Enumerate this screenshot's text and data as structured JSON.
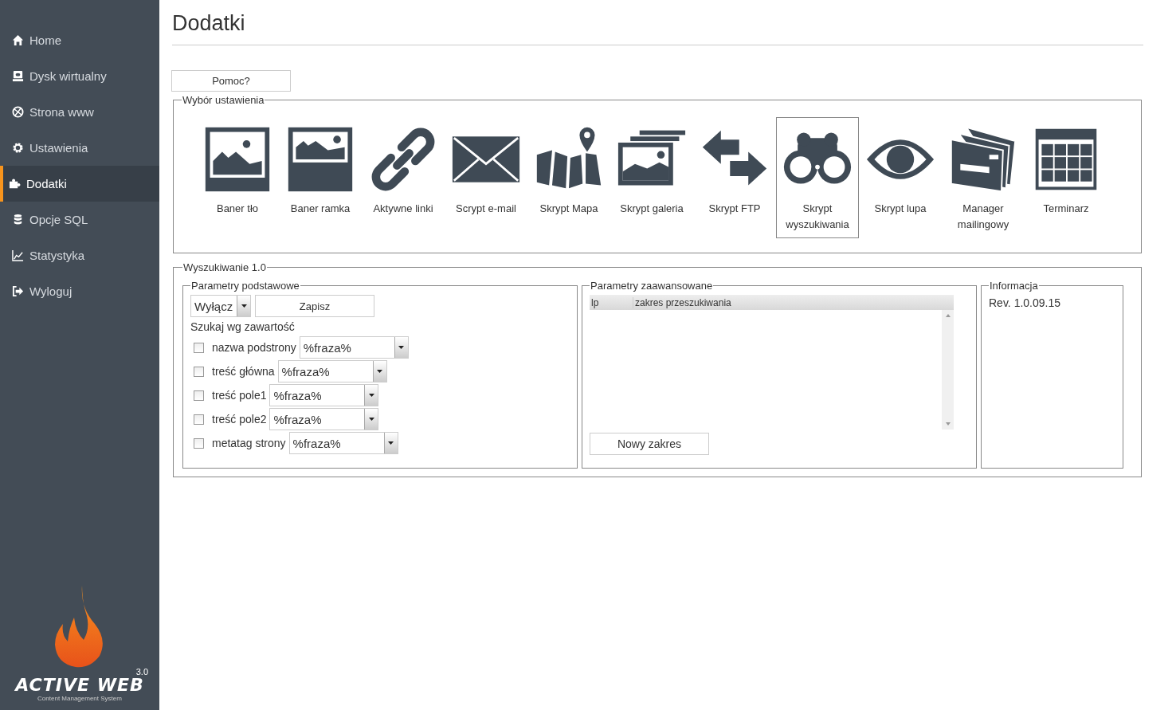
{
  "sidebar": {
    "items": [
      {
        "label": "Home",
        "selected": false
      },
      {
        "label": "Dysk wirtualny",
        "selected": false
      },
      {
        "label": "Strona www",
        "selected": false
      },
      {
        "label": "Ustawienia",
        "selected": false
      },
      {
        "label": "Dodatki",
        "selected": true
      },
      {
        "label": "Opcje SQL",
        "selected": false
      },
      {
        "label": "Statystyka",
        "selected": false
      },
      {
        "label": "Wyloguj",
        "selected": false
      }
    ],
    "logo": {
      "name": "ACTIVE WEB",
      "version": "3.0",
      "tagline": "Content Management System"
    }
  },
  "page_title": "Dodatki",
  "help_button": "Pomoc?",
  "plugins": {
    "legend": "Wybór ustawienia",
    "items": [
      {
        "label": "Baner tło",
        "selected": false
      },
      {
        "label": "Baner ramka",
        "selected": false
      },
      {
        "label": "Aktywne linki",
        "selected": false
      },
      {
        "label": "Scrypt e-mail",
        "selected": false
      },
      {
        "label": "Skrypt Mapa",
        "selected": false
      },
      {
        "label": "Skrypt galeria",
        "selected": false
      },
      {
        "label": "Skrypt FTP",
        "selected": false
      },
      {
        "label": "Skrypt wyszukiwania",
        "selected": true
      },
      {
        "label": "Skrypt lupa",
        "selected": false
      },
      {
        "label": "Manager mailingowy",
        "selected": false
      },
      {
        "label": "Terminarz",
        "selected": false
      }
    ]
  },
  "search": {
    "legend": "Wyszukiwanie 1.0",
    "basic": {
      "legend": "Parametry podstawowe",
      "mode": "Wyłącz",
      "save_button": "Zapisz",
      "section_label": "Szukaj wg zawartość",
      "fields": [
        {
          "label": "nazwa podstrony",
          "checked": false,
          "value": "%fraza%"
        },
        {
          "label": "treść główna",
          "checked": false,
          "value": "%fraza%"
        },
        {
          "label": "treść pole1",
          "checked": false,
          "value": "%fraza%"
        },
        {
          "label": "treść pole2",
          "checked": false,
          "value": "%fraza%"
        },
        {
          "label": "metatag strony",
          "checked": false,
          "value": "%fraza%"
        }
      ]
    },
    "advanced": {
      "legend": "Parametry zaawansowane",
      "table": {
        "columns": [
          "lp",
          "zakres przeszukiwania"
        ]
      },
      "new_button": "Nowy zakres"
    },
    "info": {
      "legend": "Informacja",
      "revision": "Rev. 1.0.09.15"
    }
  }
}
